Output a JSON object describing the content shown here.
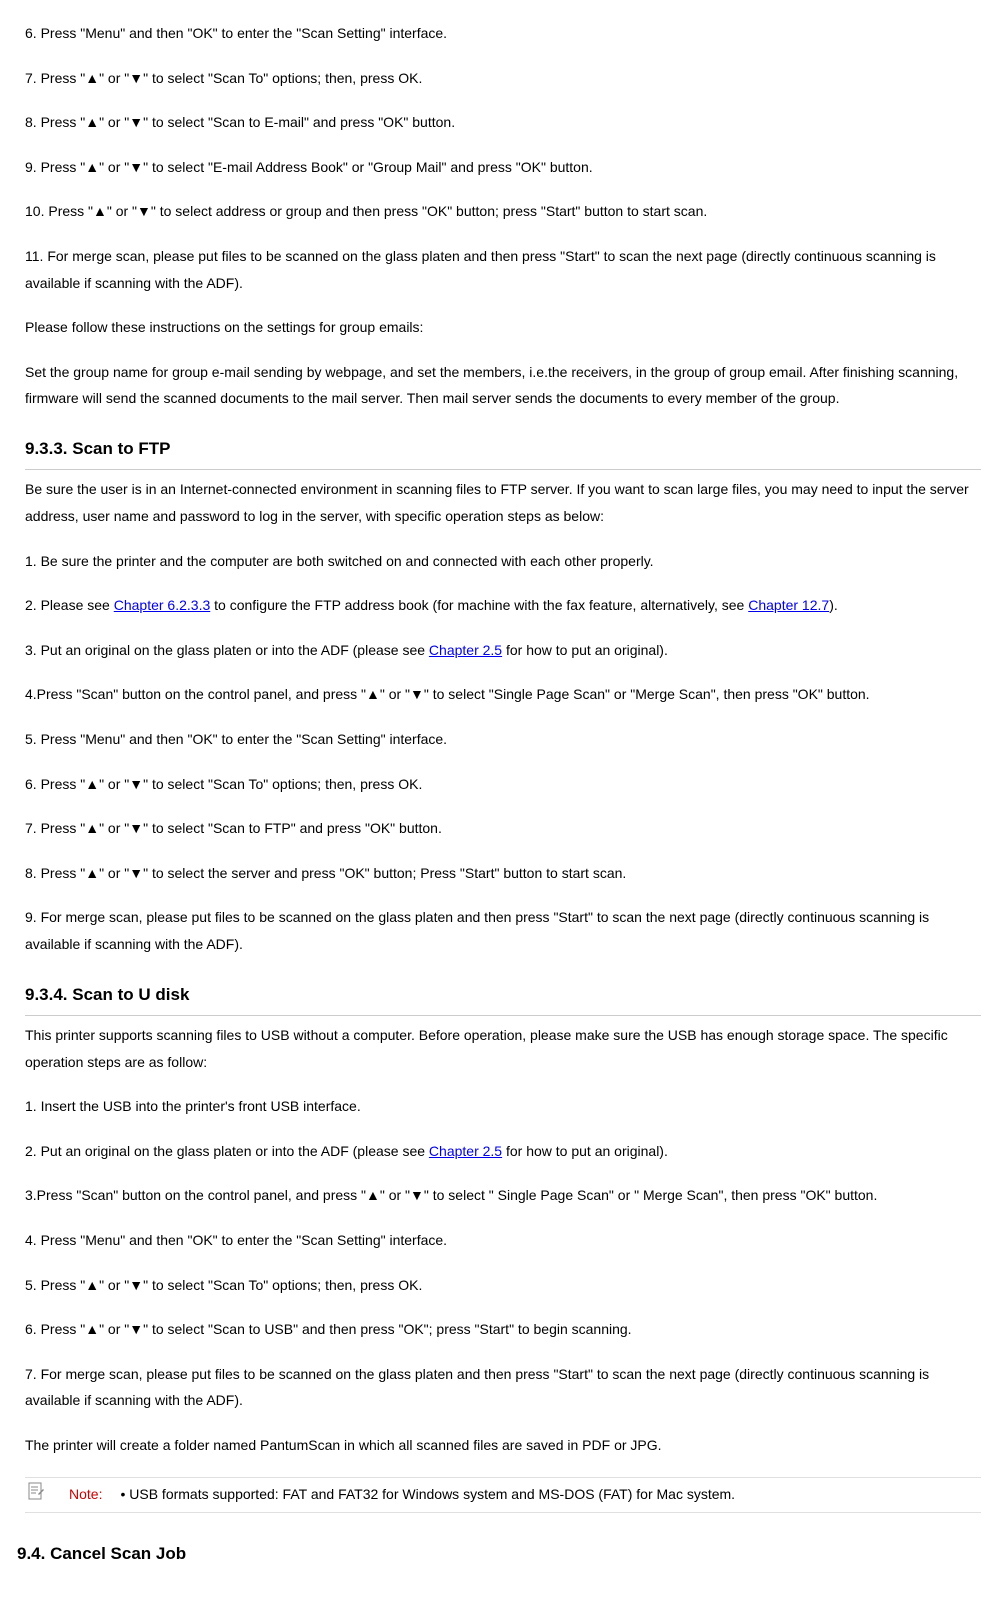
{
  "top_paras": [
    "6. Press \"Menu\" and then \"OK\" to enter the \"Scan Setting\" interface.",
    "7. Press \"▲\" or \"▼\" to select \"Scan To\" options; then, press OK.",
    "8. Press \"▲\" or \"▼\" to select \"Scan to E-mail\" and press \"OK\" button.",
    "9. Press \"▲\" or \"▼\" to select \"E-mail Address Book\" or \"Group Mail\" and press \"OK\" button.",
    "10. Press \"▲\" or \"▼\" to select address or group and then press \"OK\" button; press \"Start\" button to start scan.",
    "11. For merge scan, please put files to be scanned on the glass platen and then press \"Start\" to scan the next page (directly continuous scanning is available if scanning with the ADF).",
    "Please follow these instructions on the settings for group emails:",
    "Set the group name for group e-mail sending by webpage, and set the members, i.e.the receivers, in the group of group email. After finishing scanning, firmware will send the scanned documents to the mail server. Then mail server sends the documents to every member of the group."
  ],
  "sec933": {
    "title": "9.3.3. Scan to FTP",
    "intro": "Be sure the user is in an Internet-connected environment in scanning files to FTP server. If you want to scan large files, you may need to input the server address, user name and password to log in the server, with specific operation steps as below:",
    "s1": "1. Be sure the printer and the computer are both switched on and connected with each other properly.",
    "s2a": "2. Please see ",
    "s2link1": "Chapter 6.2.3.3",
    "s2b": " to configure the FTP address book (for machine with the fax feature, alternatively, see ",
    "s2link2": "Chapter 12.7",
    "s2c": ").",
    "s3a": "3. Put an original on the glass platen or into the ADF (please see ",
    "s3link": "Chapter 2.5",
    "s3b": " for how to put an original).",
    "s4": "4.Press \"Scan\" button on the control panel, and press \"▲\" or \"▼\" to select \"Single Page Scan\" or \"Merge Scan\", then press \"OK\" button.",
    "s5": "5. Press \"Menu\" and then \"OK\" to enter the \"Scan Setting\" interface.",
    "s6": "6. Press \"▲\" or \"▼\" to select \"Scan To\" options; then, press OK.",
    "s7": "7. Press \"▲\" or \"▼\" to select \"Scan to FTP\" and press \"OK\" button.",
    "s8": "8. Press \"▲\" or \"▼\" to select the server and press \"OK\" button; Press \"Start\" button to start scan.",
    "s9": "9. For merge scan, please put files to be scanned on the glass platen and then press \"Start\" to scan the next page (directly continuous scanning is available if scanning with the ADF)."
  },
  "sec934": {
    "title": "9.3.4. Scan to U disk",
    "intro": "This printer supports scanning files to USB without a computer. Before operation, please make sure the USB has enough storage space. The specific operation steps are as follow:",
    "s1": "1. Insert the USB into the printer's front USB interface.",
    "s2a": "2. Put an original on the glass platen or into the ADF (please see ",
    "s2link": "Chapter 2.5",
    "s2b": " for how to put an original).",
    "s3": "3.Press \"Scan\" button on the control panel, and press \"▲\" or \"▼\" to select \" Single Page Scan\" or \" Merge Scan\", then press \"OK\" button.",
    "s4": "4. Press \"Menu\" and then \"OK\" to enter the \"Scan Setting\" interface.",
    "s5": "5. Press \"▲\" or \"▼\" to select \"Scan To\" options; then, press OK.",
    "s6": "6. Press \"▲\" or \"▼\" to select \"Scan to USB\" and then press \"OK\"; press \"Start\" to begin scanning.",
    "s7": "7. For merge scan, please put files to be scanned on the glass platen and then press \"Start\" to scan the next page (directly continuous scanning is available if scanning with the ADF).",
    "outro": "The printer will create a folder named PantumScan in which all scanned files are saved in PDF or JPG."
  },
  "note": {
    "label": "Note:",
    "text": "• USB formats supported: FAT and FAT32 for Windows system and MS-DOS (FAT) for Mac system."
  },
  "sec94": {
    "title": "9.4. Cancel Scan Job"
  }
}
